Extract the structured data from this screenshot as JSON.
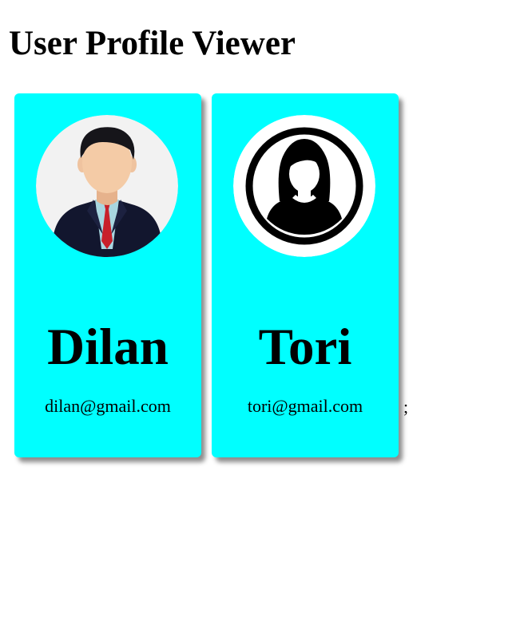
{
  "page": {
    "title": "User Profile Viewer",
    "stray_text": ";"
  },
  "profiles": [
    {
      "name": "Dilan",
      "email": "dilan@gmail.com",
      "avatar_icon": "male-avatar-icon"
    },
    {
      "name": "Tori",
      "email": "tori@gmail.com",
      "avatar_icon": "female-avatar-icon"
    }
  ],
  "colors": {
    "card_background": "#00ffff",
    "page_background": "#ffffff",
    "text": "#000000"
  }
}
